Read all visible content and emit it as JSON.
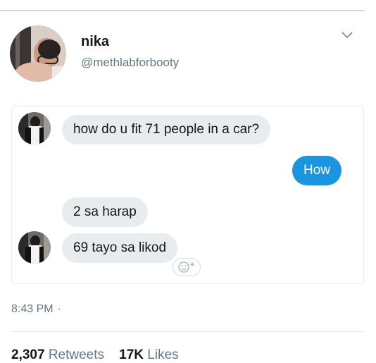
{
  "tweet": {
    "display_name": "nika",
    "handle": "@methlabforbooty",
    "time": "8:43 PM",
    "separator": "·",
    "retweets_count": "2,307",
    "retweets_label": "Retweets",
    "likes_count": "17K",
    "likes_label": "Likes"
  },
  "chat": {
    "messages": [
      {
        "sender": "other",
        "text": "how do u fit 71 people in a car?"
      },
      {
        "sender": "me",
        "text": "How"
      },
      {
        "sender": "other",
        "text": "2 sa harap"
      },
      {
        "sender": "other",
        "text": "69 tayo sa likod"
      }
    ],
    "reaction_icon": "add-reaction-icon"
  },
  "colors": {
    "outgoing_bubble": "#1b95e0",
    "incoming_bubble": "#e9ecef",
    "secondary_text": "#657786"
  },
  "icons": {
    "more_options": "chevron-down-icon"
  }
}
